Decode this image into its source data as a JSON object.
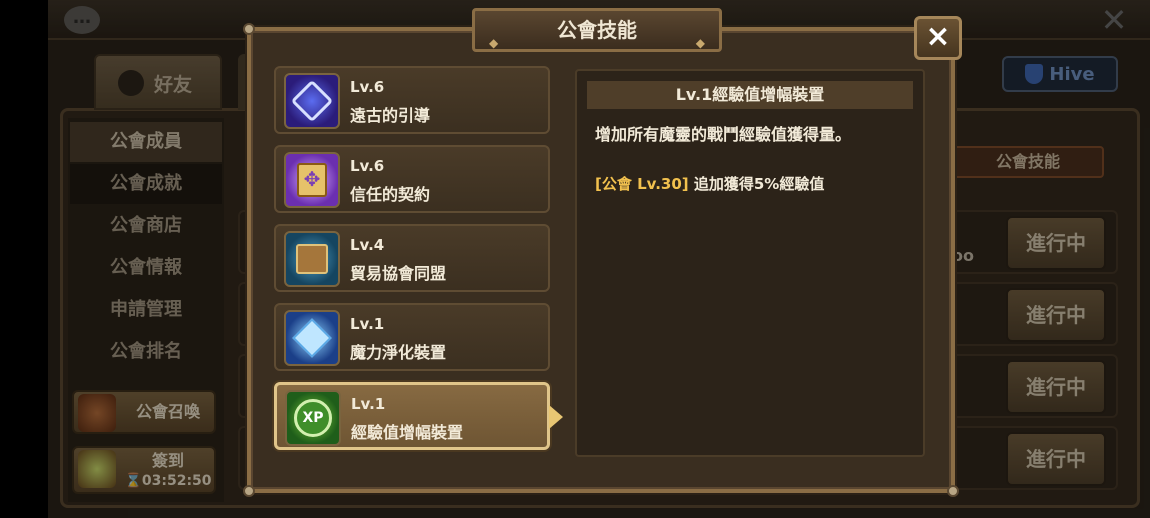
{
  "background": {
    "friends_tab": "好友",
    "hive_label": "Hive",
    "sidebar": [
      {
        "label": "公會成員"
      },
      {
        "label": "公會成就"
      },
      {
        "label": "公會商店"
      },
      {
        "label": "公會情報"
      },
      {
        "label": "申請管理"
      },
      {
        "label": "公會排名"
      }
    ],
    "summon_button": "公會召喚",
    "checkin": {
      "label": "簽到",
      "timer": "03:52:50"
    },
    "guild_skill_button": "公會技能",
    "progress_buttons": [
      "進行中",
      "進行中",
      "進行中",
      "進行中"
    ],
    "dots": "oo"
  },
  "modal": {
    "title": "公會技能",
    "close_label": "×",
    "skills": [
      {
        "level": "Lv.6",
        "name": "遠古的引導",
        "icon": "rune-icon"
      },
      {
        "level": "Lv.6",
        "name": "信任的契約",
        "icon": "contract-icon"
      },
      {
        "level": "Lv.4",
        "name": "貿易協會同盟",
        "icon": "trade-chest-icon"
      },
      {
        "level": "Lv.1",
        "name": "魔力淨化裝置",
        "icon": "crystal-icon"
      },
      {
        "level": "Lv.1",
        "name": "經驗值增幅裝置",
        "icon": "xp-icon",
        "icon_text": "XP"
      }
    ],
    "selected_index": 4,
    "detail": {
      "header": "Lv.1經驗值增幅裝置",
      "description": "增加所有魔靈的戰鬥經驗值獲得量。",
      "bonus_tag": "[公會 Lv.30]",
      "bonus_text": "追加獲得5%經驗值"
    }
  },
  "colors": {
    "accent_gold": "#e0c58a",
    "bonus_yellow": "#f2c14e",
    "text_light": "#f2ead8"
  }
}
